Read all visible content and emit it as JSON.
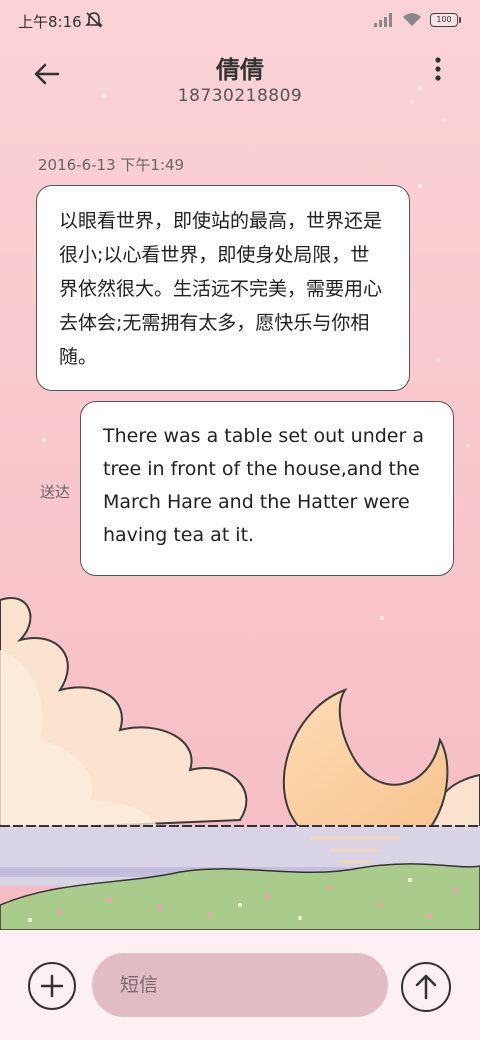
{
  "status_bar": {
    "time": "上午8:16",
    "battery": "100",
    "icons": [
      "mute-icon",
      "signal-icon",
      "wifi-icon",
      "battery-icon"
    ]
  },
  "header": {
    "back_icon": "back-arrow-icon",
    "contact_name": "倩倩",
    "contact_number": "18730218809",
    "more_icon": "more-vertical-icon"
  },
  "conversation": {
    "timestamp": "2016-6-13 下午1:49",
    "messages": [
      {
        "direction": "incoming",
        "text": "以眼看世界，即使站的最高，世界还是很小;以心看世界，即使身处局限，世界依然很大。生活远不完美，需要用心去体会;无需拥有太多，愿快乐与你相随。"
      },
      {
        "direction": "outgoing",
        "text": "There was a table set out under a tree in front of the house,and the March Hare and the Hatter were having tea at it.",
        "status": "送达"
      }
    ]
  },
  "composer": {
    "add_icon": "plus-icon",
    "placeholder": "短信",
    "send_icon": "send-arrow-up-icon"
  },
  "theme": {
    "sky": "#f7bfc5",
    "bottom_bar": "#fdf0f2",
    "input_fill": "#e2bcc5",
    "moon": "#fbd2a3"
  }
}
